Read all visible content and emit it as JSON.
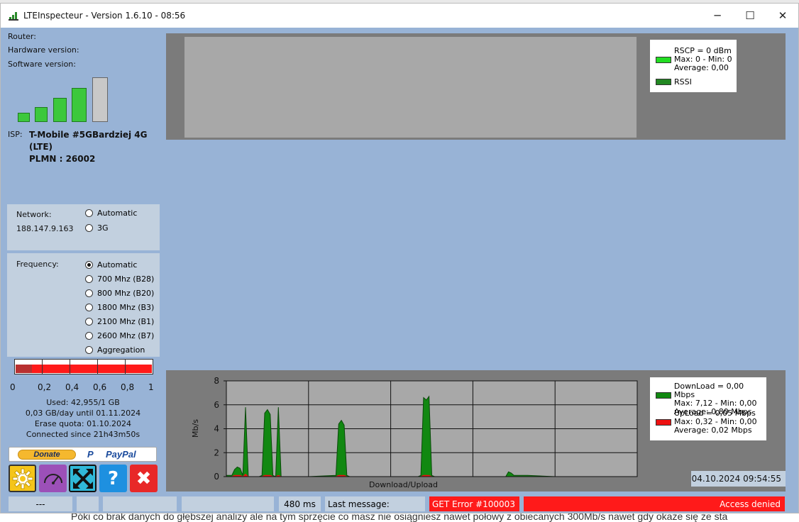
{
  "window": {
    "title": "LTEInspecteur - Version 1.6.10 - 08:56",
    "controls": {
      "minimize": "─",
      "maximize": "☐",
      "close": "✕"
    }
  },
  "device": {
    "router_label": "Router:",
    "hardware_label": "Hardware version:",
    "software_label": "Software version:",
    "signal_bars_filled": 4,
    "signal_bars_total": 5
  },
  "isp": {
    "label": "ISP:",
    "name_line1": "T-Mobile #5GBardziej 4G",
    "name_line2": "(LTE)",
    "plmn": "PLMN : 26002"
  },
  "network": {
    "label": "Network:",
    "ip": "188.147.9.163",
    "options": [
      {
        "label": "Automatic",
        "selected": false
      },
      {
        "label": "3G",
        "selected": false
      }
    ]
  },
  "frequency": {
    "label": "Frequency:",
    "options": [
      {
        "label": "Automatic",
        "selected": true
      },
      {
        "label": "700 Mhz (B28)",
        "selected": false
      },
      {
        "label": "800 Mhz (B20)",
        "selected": false
      },
      {
        "label": "1800 Mhz (B3)",
        "selected": false
      },
      {
        "label": "2100 Mhz (B1)",
        "selected": false
      },
      {
        "label": "2600 Mhz (B7)",
        "selected": false
      },
      {
        "label": "Aggregation",
        "selected": false
      }
    ]
  },
  "quota": {
    "gauge_fill": 0.12,
    "ticks": [
      "0",
      "0,2",
      "0,4",
      "0,6",
      "0,8",
      "1"
    ],
    "used": "Used: 42,955/1 GB",
    "per_day": "0,03 GB/day until 01.11.2024",
    "erase": "Erase quota: 01.10.2024",
    "connected": "Connected since 21h43m50s"
  },
  "donate": {
    "button": "Donate",
    "paypal": "PayPal"
  },
  "tools": [
    {
      "name": "settings",
      "icon": "gear-icon"
    },
    {
      "name": "speedtest",
      "icon": "speedometer-icon"
    },
    {
      "name": "fullscreen",
      "icon": "expand-arrows-icon"
    },
    {
      "name": "help",
      "icon": "question-icon",
      "glyph": "?"
    },
    {
      "name": "quit",
      "icon": "close-icon",
      "glyph": "✖"
    }
  ],
  "signal_legend": {
    "rscp": "RSCP = 0 dBm",
    "rscp_maxmin": "Max: 0 - Min: 0",
    "rscp_avg": "Average: 0,00",
    "rssi": "RSSI",
    "rscp_color": "#22dd22",
    "rssi_color": "#228822"
  },
  "chart_data": {
    "type": "area",
    "xlabel": "Download/Upload",
    "ylabel": "Mb/s",
    "ylim": [
      0,
      8
    ],
    "yticks": [
      "0",
      "2",
      "4",
      "6",
      "8"
    ],
    "x": [
      0,
      2,
      3,
      4,
      5,
      6,
      7,
      8,
      12,
      13,
      14,
      15,
      16,
      17,
      18,
      19,
      20,
      22,
      30,
      40,
      41,
      42,
      43,
      44,
      45,
      46,
      47,
      48,
      49,
      50,
      51,
      52,
      55,
      60,
      70,
      71,
      72,
      73,
      74,
      75,
      76,
      77,
      90,
      100,
      101,
      102,
      103,
      104,
      105,
      106,
      107,
      110,
      120,
      121,
      122,
      123,
      124,
      130,
      135,
      140,
      145,
      150
    ],
    "series": [
      {
        "name": "DownLoad",
        "color": "#118811",
        "values": [
          0.1,
          0.1,
          0.6,
          0.8,
          0.7,
          0.1,
          5.8,
          0.0,
          0.0,
          0.1,
          5.3,
          5.6,
          5.2,
          0.1,
          0.0,
          5.8,
          0.0,
          0.0,
          0.0,
          0.1,
          4.4,
          4.7,
          4.3,
          0.1,
          0.0,
          0.0,
          0.0,
          0.0,
          0.0,
          0.0,
          0.0,
          0.0,
          0.0,
          0.0,
          0.0,
          0.1,
          6.6,
          6.4,
          6.7,
          0.1,
          0.0,
          0.0,
          0.0,
          0.0,
          0.0,
          0.0,
          0.4,
          0.3,
          0.1,
          0.1,
          0.1,
          0.1,
          0.0,
          0.0,
          0.0,
          0.0,
          0.0,
          0.0,
          0.0,
          0.0,
          0.0,
          0.0
        ]
      },
      {
        "name": "UpLoad",
        "color": "#ee1111",
        "values": [
          0.0,
          0.0,
          0.1,
          0.1,
          0.1,
          0.0,
          0.2,
          0.0,
          0.0,
          0.0,
          0.1,
          0.1,
          0.1,
          0.0,
          0.0,
          0.1,
          0.0,
          0.0,
          0.0,
          0.0,
          0.1,
          0.1,
          0.1,
          0.0,
          0.0,
          0.0,
          0.0,
          0.0,
          0.0,
          0.0,
          0.0,
          0.0,
          0.0,
          0.0,
          0.0,
          0.0,
          0.1,
          0.1,
          0.1,
          0.0,
          0.0,
          0.0,
          0.0,
          0.0,
          0.0,
          0.0,
          0.0,
          0.0,
          0.0,
          0.0,
          0.0,
          0.0,
          0.0,
          0.0,
          0.0,
          0.0,
          0.0,
          0.0,
          0.0,
          0.0,
          0.0,
          0.0
        ]
      }
    ],
    "grid": true,
    "legend": "right"
  },
  "throughput_legend": {
    "download": "DownLoad = 0,00 Mbps",
    "download_maxmin": "Max: 7,12 - Min: 0,00",
    "download_avg": "Average: 0,80 Mbps",
    "upload": "UpLoad = 0,05 Mbps",
    "upload_maxmin": "Max: 0,32 - Min: 0,00",
    "upload_avg": "Average: 0,02 Mbps"
  },
  "timestamp": "04.10.2024 09:54:55",
  "statusbar": {
    "cell1": "---",
    "latency": "480 ms",
    "last_message": "Last message:",
    "error": "GET Error #100003",
    "access": "Access denied"
  },
  "background_text": "Póki co brak danych do głębszej analizy ale na tym sprzęcie co masz nie osiągniesz nawet połowy z obiecanych 300Mb/s nawet gdy okaże się że sta"
}
